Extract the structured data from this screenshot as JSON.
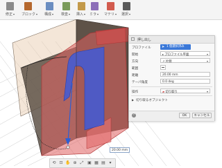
{
  "toolbar": {
    "groups": [
      {
        "label": "修正"
      },
      {
        "label": "ブロック"
      },
      {
        "label": "構成"
      },
      {
        "label": "検査"
      },
      {
        "label": "挿入"
      },
      {
        "label": "ミラ"
      },
      {
        "label": "マテリ"
      },
      {
        "label": "選択"
      }
    ]
  },
  "dialog": {
    "title": "押し出し",
    "profile": {
      "label": "プロファイル",
      "chip": "1 個選択済み"
    },
    "start": {
      "label": "開始",
      "value": "プロファイル平面"
    },
    "direction": {
      "label": "方向",
      "value": "片側"
    },
    "extent": {
      "label": "範囲"
    },
    "distance": {
      "label": "距離",
      "value": "20.00 mm"
    },
    "taper": {
      "label": "テーパ角度",
      "value": "0.0 deg"
    },
    "operation": {
      "label": "操作",
      "value": "切り取り"
    },
    "objects_to_cut": {
      "label": "切り取るオブジェクト"
    },
    "ok": "OK",
    "cancel": "キャンセル"
  },
  "viewport": {
    "distance_input": "20.00 mm"
  },
  "colors": {
    "cut_body": "#e06060",
    "profile_face": "#3f5ad8",
    "dark_body": "#5e5248",
    "ok_accent": "#2e7bd6"
  }
}
